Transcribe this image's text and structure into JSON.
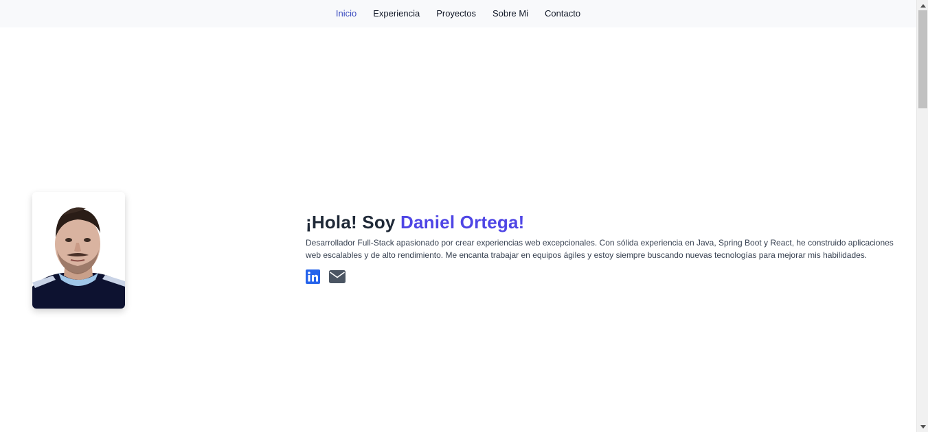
{
  "nav": {
    "items": [
      {
        "label": "Inicio",
        "active": true
      },
      {
        "label": "Experiencia",
        "active": false
      },
      {
        "label": "Proyectos",
        "active": false
      },
      {
        "label": "Sobre Mi",
        "active": false
      },
      {
        "label": "Contacto",
        "active": false
      }
    ]
  },
  "hero": {
    "greeting": "¡Hola! Soy",
    "name": "Daniel Ortega!",
    "description": "Desarrollador Full-Stack apasionado por crear experiencias web excepcionales. Con sólida experiencia en Java, Spring Boot y React, he construido aplicaciones web escalables y de alto rendimiento. Me encanta trabajar en equipos ágiles y estoy siempre buscando nuevas tecnologías para mejorar mis habilidades.",
    "socials": [
      {
        "icon": "linkedin-icon"
      },
      {
        "icon": "envelope-icon"
      }
    ]
  },
  "colors": {
    "accent": "#4f46e5",
    "nav_active": "#3b4cc0",
    "linkedin": "#2563eb",
    "mail": "#4b5563"
  }
}
